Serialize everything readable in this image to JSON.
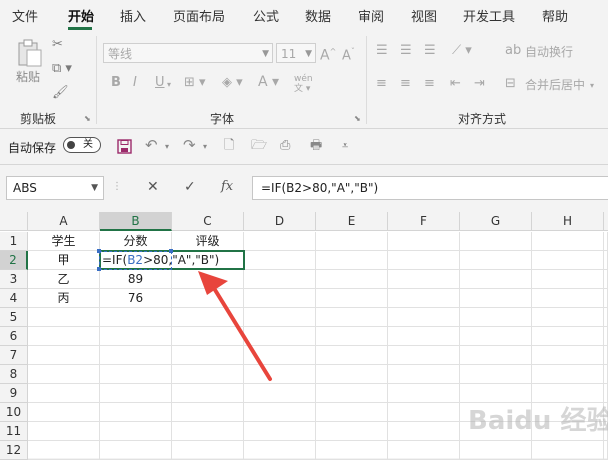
{
  "menu": {
    "tabs": [
      "文件",
      "开始",
      "插入",
      "页面布局",
      "公式",
      "数据",
      "审阅",
      "视图",
      "开发工具",
      "帮助"
    ],
    "active": "开始"
  },
  "ribbon": {
    "clipboard": {
      "paste_label": "粘贴",
      "group_label": "剪贴板"
    },
    "font": {
      "font_name": "等线",
      "font_size": "11",
      "bold": "B",
      "italic": "I",
      "underline": "U",
      "group_label": "字体"
    },
    "alignment": {
      "wrap_text": "自动换行",
      "merge_center": "合并后居中",
      "group_label": "对齐方式"
    }
  },
  "quick_access": {
    "autosave_label": "自动保存",
    "autosave_state": "关"
  },
  "formula_bar": {
    "name_box": "ABS",
    "cancel": "✕",
    "enter": "✓",
    "fx": "fx",
    "formula": "=IF(B2>80,\"A\",\"B\")"
  },
  "sheet": {
    "columns": [
      "A",
      "B",
      "C",
      "D",
      "E",
      "F",
      "G",
      "H"
    ],
    "selected_column": "B",
    "rows": [
      "1",
      "2",
      "3",
      "4",
      "5",
      "6",
      "7",
      "8",
      "9",
      "10",
      "11",
      "12"
    ],
    "selected_row": "2",
    "cells": {
      "A1": "学生",
      "B1": "分数",
      "C1": "评级",
      "A2": "甲",
      "A3": "乙",
      "B3": "89",
      "A4": "丙",
      "B4": "76"
    },
    "editing_cell": {
      "ref": "B2",
      "parts": [
        "=IF(",
        "B2",
        ">80,\"A\",\"B\")"
      ]
    }
  },
  "colors": {
    "accent": "#217346",
    "reference_blue": "#3a6fc4",
    "arrow": "#e8453c"
  },
  "watermark": "Baidu 经验"
}
